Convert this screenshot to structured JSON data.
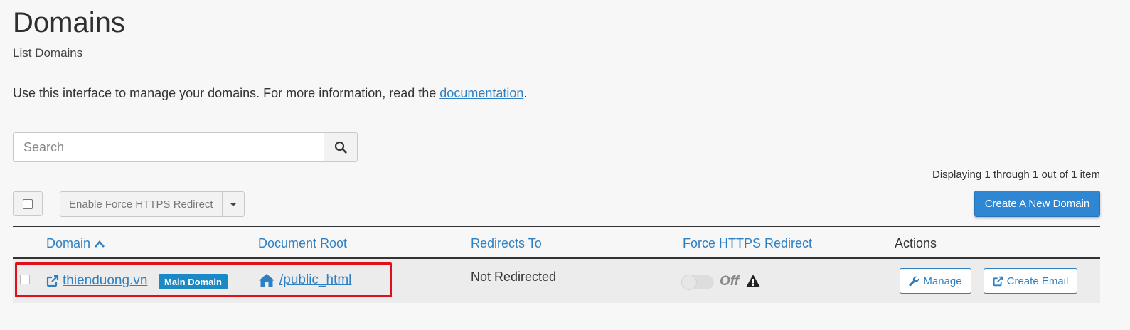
{
  "header": {
    "title": "Domains",
    "subtitle": "List Domains"
  },
  "intro": {
    "text": "Use this interface to manage your domains. For more information, read the ",
    "link_label": "documentation",
    "suffix": "."
  },
  "search": {
    "placeholder": "Search",
    "value": ""
  },
  "pager": {
    "info": "Displaying 1 through 1 out of 1 item"
  },
  "toolbar": {
    "bulk_action_label": "Enable Force HTTPS Redirect",
    "create_label": "Create A New Domain"
  },
  "table": {
    "columns": {
      "domain": "Domain",
      "document_root": "Document Root",
      "redirects_to": "Redirects To",
      "force_https": "Force HTTPS Redirect",
      "actions": "Actions"
    },
    "rows": [
      {
        "domain": "thienduong.vn",
        "badge": "Main Domain",
        "document_root": "/public_html",
        "redirects_to": "Not Redirected",
        "force_https_state": "Off",
        "manage_label": "Manage",
        "email_label": "Create Email"
      }
    ]
  },
  "colors": {
    "accent": "#2f86d3",
    "link": "#2f80c2",
    "badge": "#1b89c5",
    "highlight": "#e0101a"
  },
  "icons": [
    "search-icon",
    "sort-asc-icon",
    "external-link-icon",
    "home-icon",
    "warning-icon",
    "wrench-icon",
    "caret-down-icon"
  ]
}
